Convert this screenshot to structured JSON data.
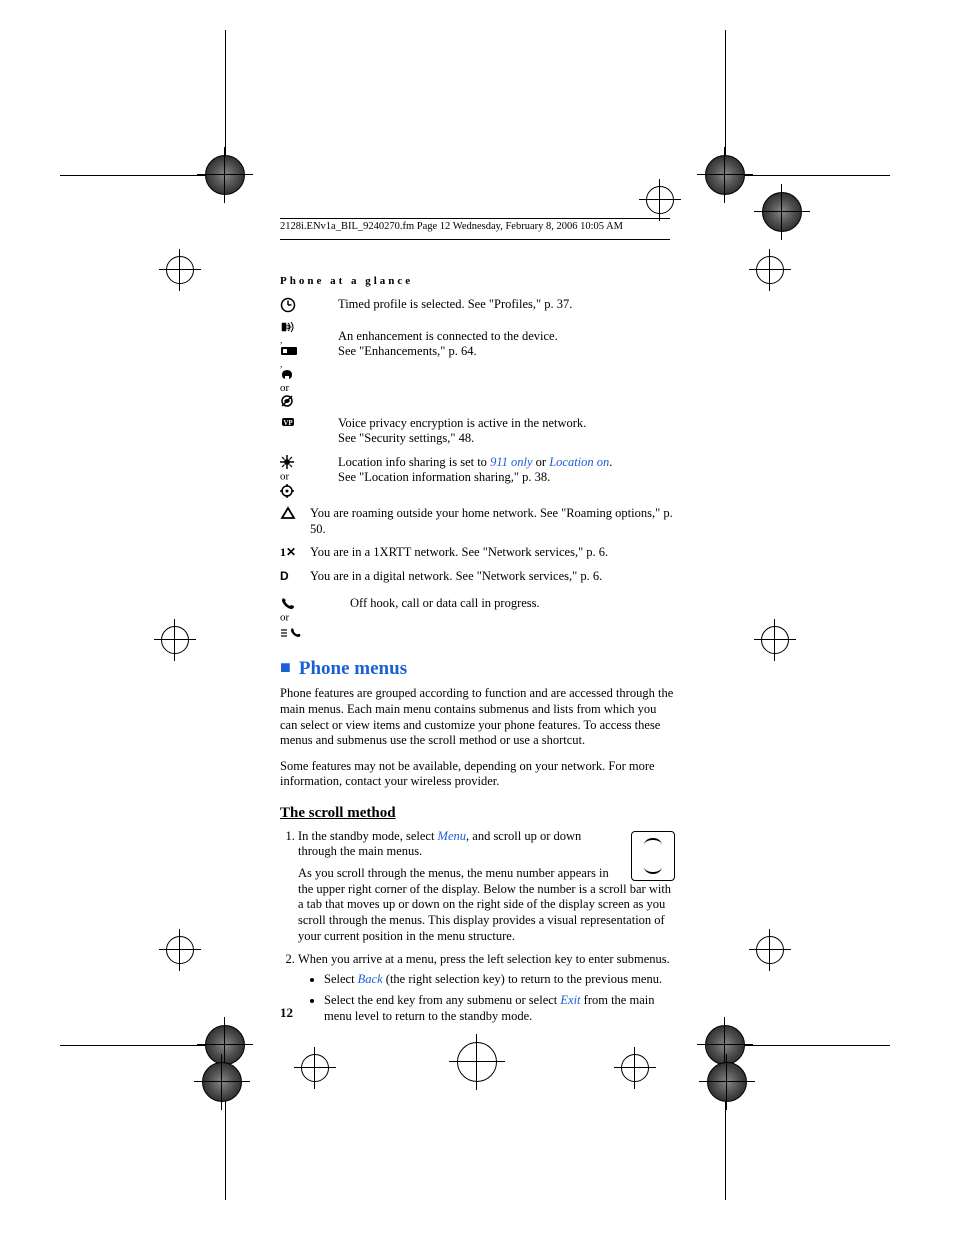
{
  "header_line": "2128i.ENv1a_BIL_9240270.fm  Page 12  Wednesday, February 8, 2006  10:05 AM",
  "section_label": "Phone at a glance",
  "rows": {
    "timed": "Timed profile is selected. See \"Profiles,\" p. 37.",
    "enh_or": "or",
    "enh_l1": "An enhancement is connected to the device.",
    "enh_l2": "See \"Enhancements,\" p. 64.",
    "voice_l1": "Voice privacy encryption is active in the network.",
    "voice_l2": "See \"Security settings,\" 48.",
    "loc_or": "or",
    "loc_l1a": "Location info sharing is set to ",
    "loc_911": "911 only",
    "loc_mid": " or ",
    "loc_on": "Location on",
    "loc_period": ".",
    "loc_l2": "See \"Location information sharing,\" p. 38.",
    "roam": "You are roaming outside your home network. See \"Roaming options,\" p. 50.",
    "xrtt": "You are in a 1XRTT network. See \"Network services,\" p. 6.",
    "digital": "You are in a digital network. See \"Network services,\" p. 6.",
    "hook_or": "or",
    "hook": "Off hook, call or data call in progress."
  },
  "heading": "Phone menus",
  "p1": "Phone features are grouped according to function and are accessed through the main menus. Each main menu contains submenus and lists from which you can select or view items and customize your phone features. To access these menus and submenus use the scroll method or use a shortcut.",
  "p2": "Some features may not be available, depending on your network. For more information, contact your wireless provider.",
  "scroll_heading": "The scroll method",
  "step1_a": "In the standby mode, select ",
  "step1_menu": "Menu",
  "step1_b": ", and scroll up or down through the main menus.",
  "step1_sub": "As you scroll through the menus, the menu number appears in the upper right corner of the display. Below the number is a scroll bar with a tab that moves up or down on the right side of the display screen as you scroll through the menus. This display provides a visual representation of your current position in the menu structure.",
  "step2": "When you arrive at a menu, press the left selection key to enter submenus.",
  "b1a": "Select ",
  "b1_back": "Back",
  "b1b": " (the right selection key) to return to the previous menu.",
  "b2a": "Select the end key from any submenu or select ",
  "b2_exit": "Exit",
  "b2b": " from the main menu level to return to the standby mode.",
  "page_number": "12"
}
